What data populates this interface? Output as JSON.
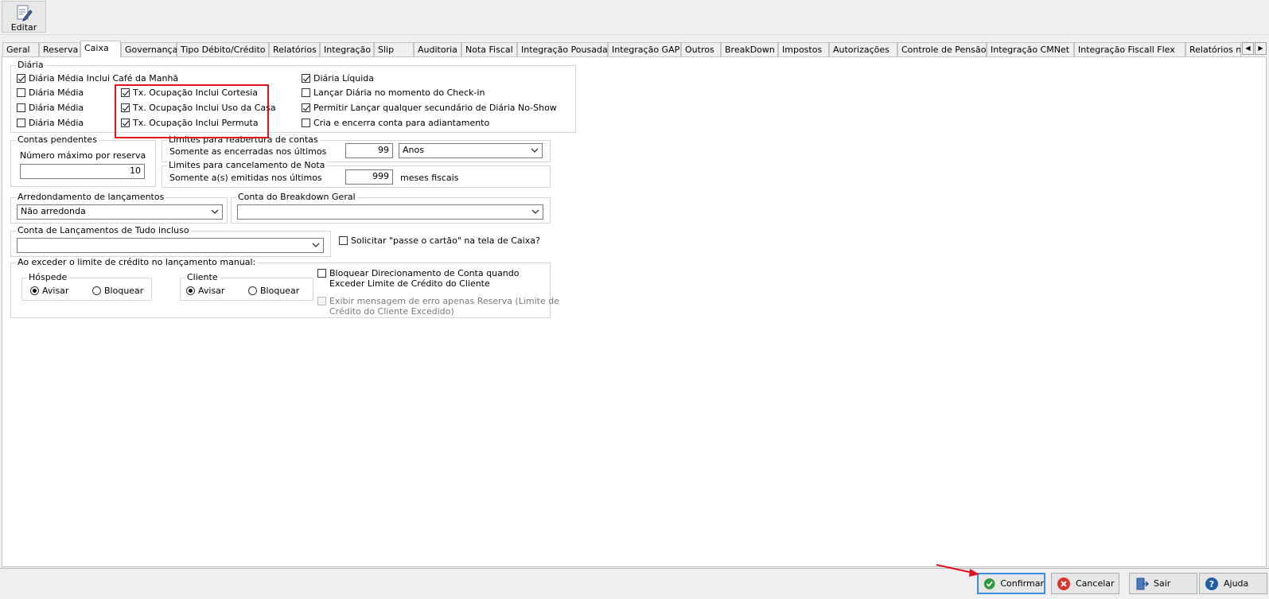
{
  "toolbar": {
    "edit_label": "Editar"
  },
  "tabs": [
    "Geral",
    "Reserva",
    "Caixa",
    "Governança",
    "Tipo Débito/Crédito",
    "Relatórios",
    "Integração",
    "Slip",
    "Auditoria",
    "Nota Fiscal",
    "Integração Pousada",
    "Integração GAP",
    "Outros",
    "BreakDown",
    "Impostos",
    "Autorizações",
    "Controle de Pensão",
    "Integração CMNet",
    "Integração Fiscall Flex",
    "Relatórios não Fisca"
  ],
  "active_tab": "Caixa",
  "diaria": {
    "title": "Diária",
    "col1": [
      {
        "label": "Diária Média Inclui Café da Manhã",
        "checked": true
      },
      {
        "label": "Diária Média",
        "checked": false
      },
      {
        "label": "Diária Média",
        "checked": false
      },
      {
        "label": "Diária Média",
        "checked": false
      }
    ],
    "col2": [
      {
        "label": "Tx. Ocupação Inclui Cortesia",
        "checked": true
      },
      {
        "label": "Tx. Ocupação Inclui Uso da Casa",
        "checked": true
      },
      {
        "label": "Tx. Ocupação Inclui Permuta",
        "checked": true
      }
    ],
    "col3": [
      {
        "label": "Diária Líquida",
        "checked": true
      },
      {
        "label": "Lançar Diária no momento do Check-in",
        "checked": false
      },
      {
        "label": "Permitir Lançar qualquer secundário de Diária No-Show",
        "checked": true
      },
      {
        "label": "Cria e encerra conta para adiantamento",
        "checked": false
      }
    ]
  },
  "contas_pendentes": {
    "title": "Contas pendentes",
    "label": "Número máximo por reserva",
    "value": "10"
  },
  "reabertura": {
    "title": "Limites para reabertura de contas",
    "label": "Somente as encerradas nos últimos",
    "value": "99",
    "unit": "Anos"
  },
  "cancelamento": {
    "title": "Limites para cancelamento de Nota",
    "label": "Somente a(s) emitidas nos últimos",
    "value": "999",
    "unit": "meses fiscais"
  },
  "arredondamento": {
    "title": "Arredondamento de lançamentos",
    "value": "Não arredonda"
  },
  "breakdown": {
    "title": "Conta do Breakdown Geral",
    "value": ""
  },
  "tudo_incluso": {
    "title": "Conta de Lançamentos de Tudo incluso",
    "value": ""
  },
  "solicitar_cartao": {
    "label": "Solicitar \"passe o cartão\" na tela de Caixa?",
    "checked": false
  },
  "limite_credito": {
    "title": "Ao exceder o limite de crédito no lançamento manual:",
    "hospede": {
      "title": "Hóspede",
      "opt1": "Avisar",
      "opt2": "Bloquear",
      "selected": "Avisar"
    },
    "cliente": {
      "title": "Cliente",
      "opt1": "Avisar",
      "opt2": "Bloquear",
      "selected": "Avisar"
    },
    "bloquear_direcionamento": {
      "line1": "Bloquear Direcionamento de Conta quando",
      "line2": "Exceder Limite de Crédito do Cliente",
      "checked": false
    },
    "exibir_mensagem": {
      "line1": "Exibir mensagem de erro apenas Reserva (Limite de",
      "line2": "Crédito do Cliente Excedido)",
      "checked": false,
      "disabled": true
    }
  },
  "buttons": {
    "confirm": "Confirmar",
    "cancel": "Cancelar",
    "exit": "Sair",
    "help": "Ajuda"
  },
  "colors": {
    "highlight": "#e0141e",
    "confirm_icon": "#2e9a3c",
    "cancel_icon": "#d9342b",
    "help_icon": "#1f5fa6",
    "focus": "#3d8ee0"
  }
}
